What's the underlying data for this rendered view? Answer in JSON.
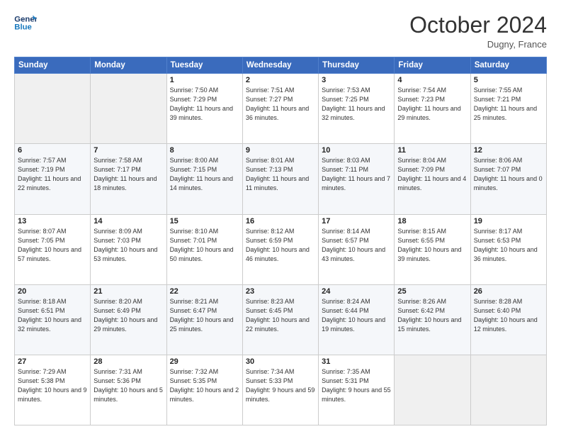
{
  "header": {
    "logo_line1": "General",
    "logo_line2": "Blue",
    "month": "October 2024",
    "location": "Dugny, France"
  },
  "weekdays": [
    "Sunday",
    "Monday",
    "Tuesday",
    "Wednesday",
    "Thursday",
    "Friday",
    "Saturday"
  ],
  "weeks": [
    [
      {
        "day": "",
        "sunrise": "",
        "sunset": "",
        "daylight": ""
      },
      {
        "day": "",
        "sunrise": "",
        "sunset": "",
        "daylight": ""
      },
      {
        "day": "1",
        "sunrise": "Sunrise: 7:50 AM",
        "sunset": "Sunset: 7:29 PM",
        "daylight": "Daylight: 11 hours and 39 minutes."
      },
      {
        "day": "2",
        "sunrise": "Sunrise: 7:51 AM",
        "sunset": "Sunset: 7:27 PM",
        "daylight": "Daylight: 11 hours and 36 minutes."
      },
      {
        "day": "3",
        "sunrise": "Sunrise: 7:53 AM",
        "sunset": "Sunset: 7:25 PM",
        "daylight": "Daylight: 11 hours and 32 minutes."
      },
      {
        "day": "4",
        "sunrise": "Sunrise: 7:54 AM",
        "sunset": "Sunset: 7:23 PM",
        "daylight": "Daylight: 11 hours and 29 minutes."
      },
      {
        "day": "5",
        "sunrise": "Sunrise: 7:55 AM",
        "sunset": "Sunset: 7:21 PM",
        "daylight": "Daylight: 11 hours and 25 minutes."
      }
    ],
    [
      {
        "day": "6",
        "sunrise": "Sunrise: 7:57 AM",
        "sunset": "Sunset: 7:19 PM",
        "daylight": "Daylight: 11 hours and 22 minutes."
      },
      {
        "day": "7",
        "sunrise": "Sunrise: 7:58 AM",
        "sunset": "Sunset: 7:17 PM",
        "daylight": "Daylight: 11 hours and 18 minutes."
      },
      {
        "day": "8",
        "sunrise": "Sunrise: 8:00 AM",
        "sunset": "Sunset: 7:15 PM",
        "daylight": "Daylight: 11 hours and 14 minutes."
      },
      {
        "day": "9",
        "sunrise": "Sunrise: 8:01 AM",
        "sunset": "Sunset: 7:13 PM",
        "daylight": "Daylight: 11 hours and 11 minutes."
      },
      {
        "day": "10",
        "sunrise": "Sunrise: 8:03 AM",
        "sunset": "Sunset: 7:11 PM",
        "daylight": "Daylight: 11 hours and 7 minutes."
      },
      {
        "day": "11",
        "sunrise": "Sunrise: 8:04 AM",
        "sunset": "Sunset: 7:09 PM",
        "daylight": "Daylight: 11 hours and 4 minutes."
      },
      {
        "day": "12",
        "sunrise": "Sunrise: 8:06 AM",
        "sunset": "Sunset: 7:07 PM",
        "daylight": "Daylight: 11 hours and 0 minutes."
      }
    ],
    [
      {
        "day": "13",
        "sunrise": "Sunrise: 8:07 AM",
        "sunset": "Sunset: 7:05 PM",
        "daylight": "Daylight: 10 hours and 57 minutes."
      },
      {
        "day": "14",
        "sunrise": "Sunrise: 8:09 AM",
        "sunset": "Sunset: 7:03 PM",
        "daylight": "Daylight: 10 hours and 53 minutes."
      },
      {
        "day": "15",
        "sunrise": "Sunrise: 8:10 AM",
        "sunset": "Sunset: 7:01 PM",
        "daylight": "Daylight: 10 hours and 50 minutes."
      },
      {
        "day": "16",
        "sunrise": "Sunrise: 8:12 AM",
        "sunset": "Sunset: 6:59 PM",
        "daylight": "Daylight: 10 hours and 46 minutes."
      },
      {
        "day": "17",
        "sunrise": "Sunrise: 8:14 AM",
        "sunset": "Sunset: 6:57 PM",
        "daylight": "Daylight: 10 hours and 43 minutes."
      },
      {
        "day": "18",
        "sunrise": "Sunrise: 8:15 AM",
        "sunset": "Sunset: 6:55 PM",
        "daylight": "Daylight: 10 hours and 39 minutes."
      },
      {
        "day": "19",
        "sunrise": "Sunrise: 8:17 AM",
        "sunset": "Sunset: 6:53 PM",
        "daylight": "Daylight: 10 hours and 36 minutes."
      }
    ],
    [
      {
        "day": "20",
        "sunrise": "Sunrise: 8:18 AM",
        "sunset": "Sunset: 6:51 PM",
        "daylight": "Daylight: 10 hours and 32 minutes."
      },
      {
        "day": "21",
        "sunrise": "Sunrise: 8:20 AM",
        "sunset": "Sunset: 6:49 PM",
        "daylight": "Daylight: 10 hours and 29 minutes."
      },
      {
        "day": "22",
        "sunrise": "Sunrise: 8:21 AM",
        "sunset": "Sunset: 6:47 PM",
        "daylight": "Daylight: 10 hours and 25 minutes."
      },
      {
        "day": "23",
        "sunrise": "Sunrise: 8:23 AM",
        "sunset": "Sunset: 6:45 PM",
        "daylight": "Daylight: 10 hours and 22 minutes."
      },
      {
        "day": "24",
        "sunrise": "Sunrise: 8:24 AM",
        "sunset": "Sunset: 6:44 PM",
        "daylight": "Daylight: 10 hours and 19 minutes."
      },
      {
        "day": "25",
        "sunrise": "Sunrise: 8:26 AM",
        "sunset": "Sunset: 6:42 PM",
        "daylight": "Daylight: 10 hours and 15 minutes."
      },
      {
        "day": "26",
        "sunrise": "Sunrise: 8:28 AM",
        "sunset": "Sunset: 6:40 PM",
        "daylight": "Daylight: 10 hours and 12 minutes."
      }
    ],
    [
      {
        "day": "27",
        "sunrise": "Sunrise: 7:29 AM",
        "sunset": "Sunset: 5:38 PM",
        "daylight": "Daylight: 10 hours and 9 minutes."
      },
      {
        "day": "28",
        "sunrise": "Sunrise: 7:31 AM",
        "sunset": "Sunset: 5:36 PM",
        "daylight": "Daylight: 10 hours and 5 minutes."
      },
      {
        "day": "29",
        "sunrise": "Sunrise: 7:32 AM",
        "sunset": "Sunset: 5:35 PM",
        "daylight": "Daylight: 10 hours and 2 minutes."
      },
      {
        "day": "30",
        "sunrise": "Sunrise: 7:34 AM",
        "sunset": "Sunset: 5:33 PM",
        "daylight": "Daylight: 9 hours and 59 minutes."
      },
      {
        "day": "31",
        "sunrise": "Sunrise: 7:35 AM",
        "sunset": "Sunset: 5:31 PM",
        "daylight": "Daylight: 9 hours and 55 minutes."
      },
      {
        "day": "",
        "sunrise": "",
        "sunset": "",
        "daylight": ""
      },
      {
        "day": "",
        "sunrise": "",
        "sunset": "",
        "daylight": ""
      }
    ]
  ]
}
